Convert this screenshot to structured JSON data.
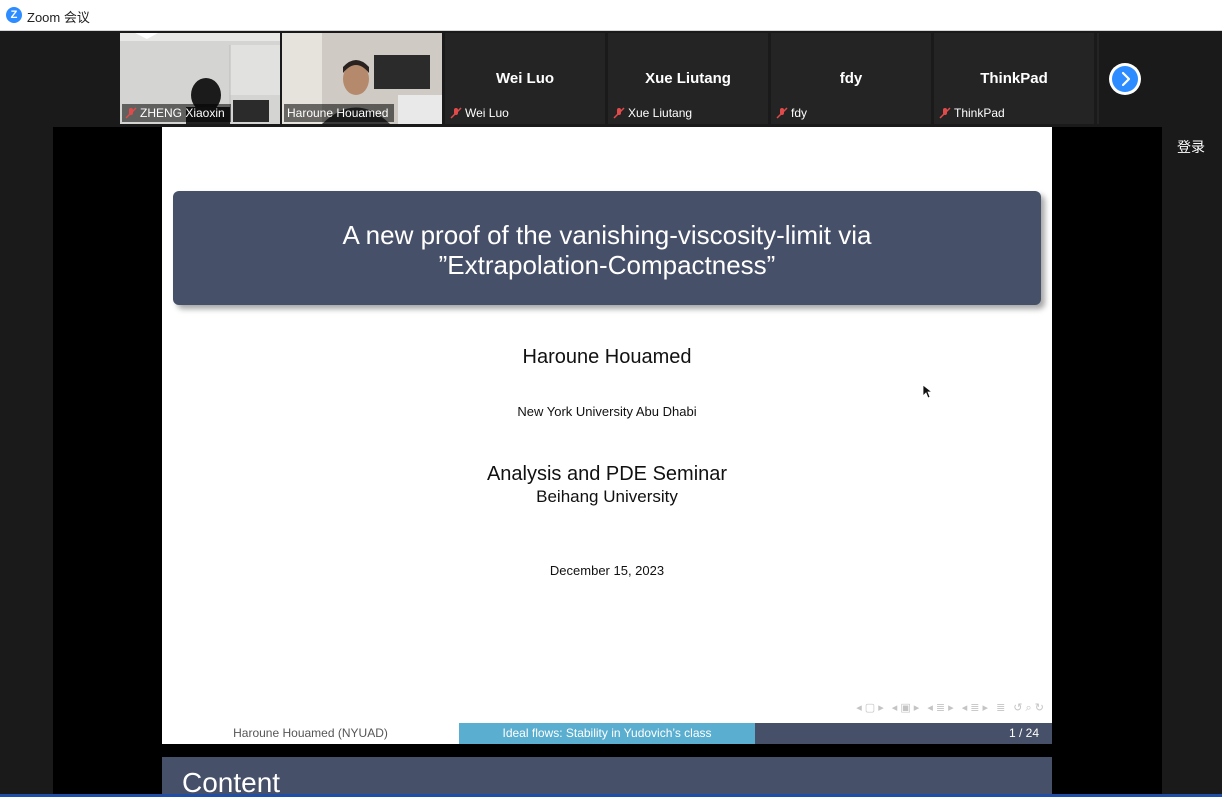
{
  "window": {
    "title": "Zoom 会议",
    "logo": "Z"
  },
  "gallery": {
    "participants": [
      {
        "name": "ZHENG Xiaoxin",
        "video": true,
        "muted": true,
        "active": false
      },
      {
        "name": "Haroune Houamed",
        "video": true,
        "muted": false,
        "active": true
      },
      {
        "name": "Wei Luo",
        "video": false,
        "muted": true,
        "active": false
      },
      {
        "name": "Xue Liutang",
        "video": false,
        "muted": true,
        "active": false
      },
      {
        "name": "fdy",
        "video": false,
        "muted": true,
        "active": false
      },
      {
        "name": "ThinkPad",
        "video": false,
        "muted": true,
        "active": false
      }
    ],
    "next_icon": "chevron-right-icon"
  },
  "slide": {
    "title_line1": "A new proof of the vanishing-viscosity-limit via",
    "title_line2": "”Extrapolation-Compactness”",
    "author": "Haroune Houamed",
    "institution": "New York University Abu Dhabi",
    "seminar": "Analysis and PDE Seminar",
    "university": "Beihang University",
    "date": "December 15, 2023",
    "footer_left": "Haroune Houamed  (NYUAD)",
    "footer_mid": "Ideal flows: Stability in Yudovich’s class",
    "footer_right": "1 / 24",
    "nav_icons": [
      "◂ ▢ ▸",
      "◂ ▣ ▸",
      "◂ ≣ ▸",
      "◂ ≣ ▸",
      "≣",
      "↺ ⌕ ↻"
    ]
  },
  "next_slide": {
    "title": "Content"
  },
  "right_panel": {
    "login_label": "登录"
  },
  "colors": {
    "accent": "#2d8cff",
    "beamer_blue": "#475069",
    "beamer_cyan": "#5aaecf",
    "active_border": "#9ec63d"
  }
}
